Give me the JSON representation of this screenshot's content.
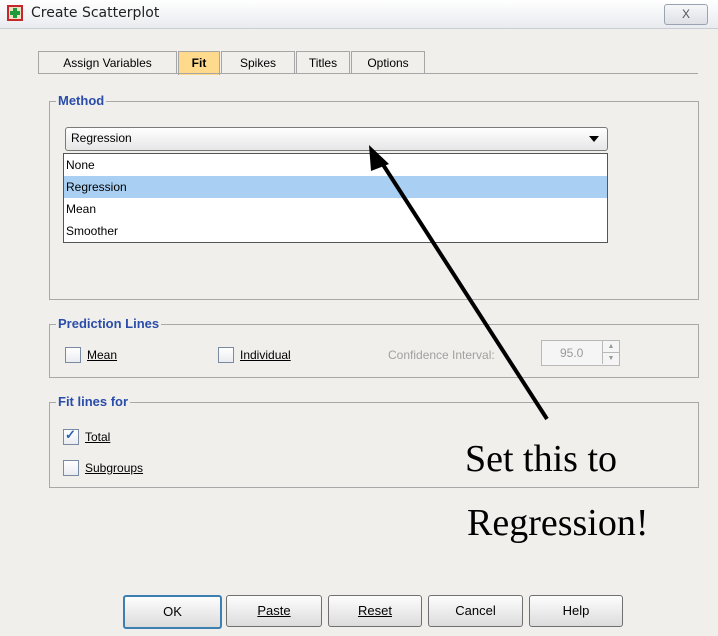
{
  "window": {
    "title": "Create Scatterplot",
    "close_symbol": "X"
  },
  "tabs": [
    "Assign Variables",
    "Fit",
    "Spikes",
    "Titles",
    "Options"
  ],
  "active_tab": "Fit",
  "method": {
    "legend": "Method",
    "selected": "Regression",
    "options": [
      "None",
      "Regression",
      "Mean",
      "Smoother"
    ]
  },
  "prediction_lines": {
    "legend": "Prediction Lines",
    "mean_label": "Mean",
    "individual_label": "Individual",
    "confidence_label": "Confidence Interval:",
    "confidence_value": "95.0"
  },
  "fit_lines_for": {
    "legend": "Fit lines for",
    "total_label": "Total",
    "total_checked": true,
    "subgroups_label": "Subgroups",
    "subgroups_checked": false
  },
  "buttons": [
    "OK",
    "Paste",
    "Reset",
    "Cancel",
    "Help"
  ],
  "annotation": {
    "line1": "Set this to",
    "line2": "Regression!"
  },
  "colors": {
    "accent": "#2a4da8",
    "active_tab": "#ffda8c",
    "selected_row": "#a9cff2"
  }
}
